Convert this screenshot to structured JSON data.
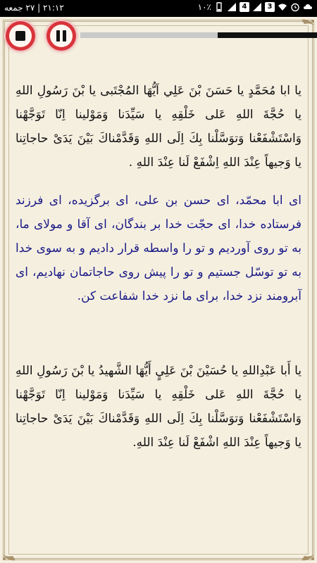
{
  "status_bar": {
    "time_date": "۲۱:۱۲ | ۲۷ جمعه",
    "battery": "۱۰٪",
    "sim1": "3",
    "sim2": "4"
  },
  "player": {
    "progress_fraction": 0.58
  },
  "paragraphs": [
    {
      "lang": "arabic",
      "text": "يا ابا مُحَمَّدٍ يا حَسَنَ بْنَ عَلِي اَيُّهَا المُجْتَبى يا بْنَ رَسُولِ اللهِ يا حُجَّةَ اللهِ عَلى خَلْقِهِ يا سَيِّدَنا وَمَوْلينا اِنّا تَوَجَّهْنا وَاسْتَشْفَعْنا وَتوَسَّلْنا بِكَ اِلَى اللهِ وَقَدَّمْناكَ بَيْنَ يَدَىْ حاجاتِنا يا وَجيهاً عِنْدَ اللهِ اِشْفَعْ لَنا عِنْدَ اللهِ ."
    },
    {
      "lang": "persian",
      "text": "اى ابا محمّد، اى حسن بن على، اى برگزيده، اى فرزند فرستاده خدا، اى حجّت خدا بر بندگان، اى آقا و مولاى ما، به تو روى آورديم و تو را واسطه قرار داديم و به سوى خدا به تو توسّل جستيم و تو را پيش روى حاجاتمان نهاديم، اى آبرومند نزد خدا، براى ما نزد خدا شفاعت كن."
    },
    {
      "lang": "arabic",
      "text": "يا أَبا عَبْدِاللهِ يا حُسَيْنَ بْنَ عَلِيٍ أَيُّهَا الشَّهيدُ يا بْنَ رَسُولِ اللهِ يا حُجَّةَ اللهِ عَلى خَلْقِهِ يا سَيِّدَنا وَمَوْلينا اِنّا تَوَجَّهْنا وَاسْتَشْفَعْنا وَتوَسَّلْنا بِكَ اِلَى اللهِ وَقَدَّمْناكَ بَيْنَ يَدَىْ حاجاتِنا يا وَجيهاً عِنْدَ اللهِ اشْفَعْ لَنا عِنْدَ اللهِ."
    }
  ]
}
